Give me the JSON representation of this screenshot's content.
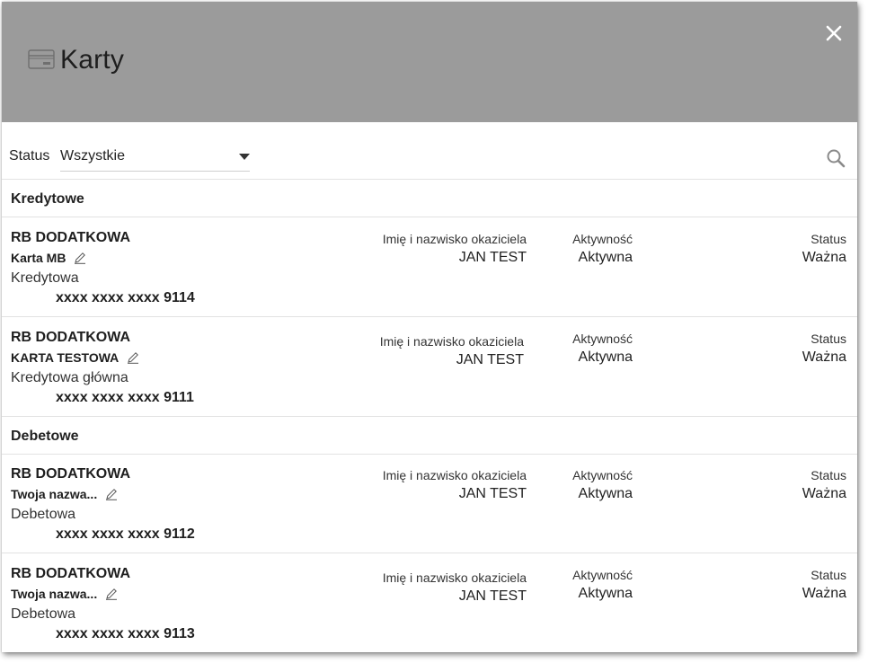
{
  "dialog": {
    "title": "Karty",
    "title_icon": "credit-card-icon",
    "close_icon": "close-icon"
  },
  "filter": {
    "status_label": "Status",
    "status_value": "Wszystkie",
    "caret_icon": "caret-down-icon",
    "search_icon": "search-icon"
  },
  "columns": {
    "holder": "Imię i nazwisko okaziciela",
    "activity": "Aktywność",
    "status": "Status"
  },
  "sections": [
    {
      "title": "Kredytowe",
      "cards": [
        {
          "product": "RB DODATKOWA",
          "name": "Karta MB",
          "type": "Kredytowa",
          "number": "xxxx xxxx xxxx 9114",
          "holder": "JAN TEST",
          "activity": "Aktywna",
          "status": "Ważna"
        },
        {
          "product": "RB DODATKOWA",
          "name": "KARTA TESTOWA",
          "type": "Kredytowa główna",
          "number": "xxxx xxxx xxxx 9111",
          "holder": "JAN TEST",
          "activity": "Aktywna",
          "status": "Ważna"
        }
      ]
    },
    {
      "title": "Debetowe",
      "cards": [
        {
          "product": "RB DODATKOWA",
          "name": "Twoja nazwa...",
          "type": "Debetowa",
          "number": "xxxx xxxx xxxx 9112",
          "holder": "JAN TEST",
          "activity": "Aktywna",
          "status": "Ważna"
        },
        {
          "product": "RB DODATKOWA",
          "name": "Twoja nazwa...",
          "type": "Debetowa",
          "number": "xxxx xxxx xxxx 9113",
          "holder": "JAN TEST",
          "activity": "Aktywna",
          "status": "Ważna"
        }
      ]
    }
  ],
  "colors": {
    "header_bg": "#9b9b9b",
    "divider": "#e2e2e2",
    "text": "#222222"
  }
}
